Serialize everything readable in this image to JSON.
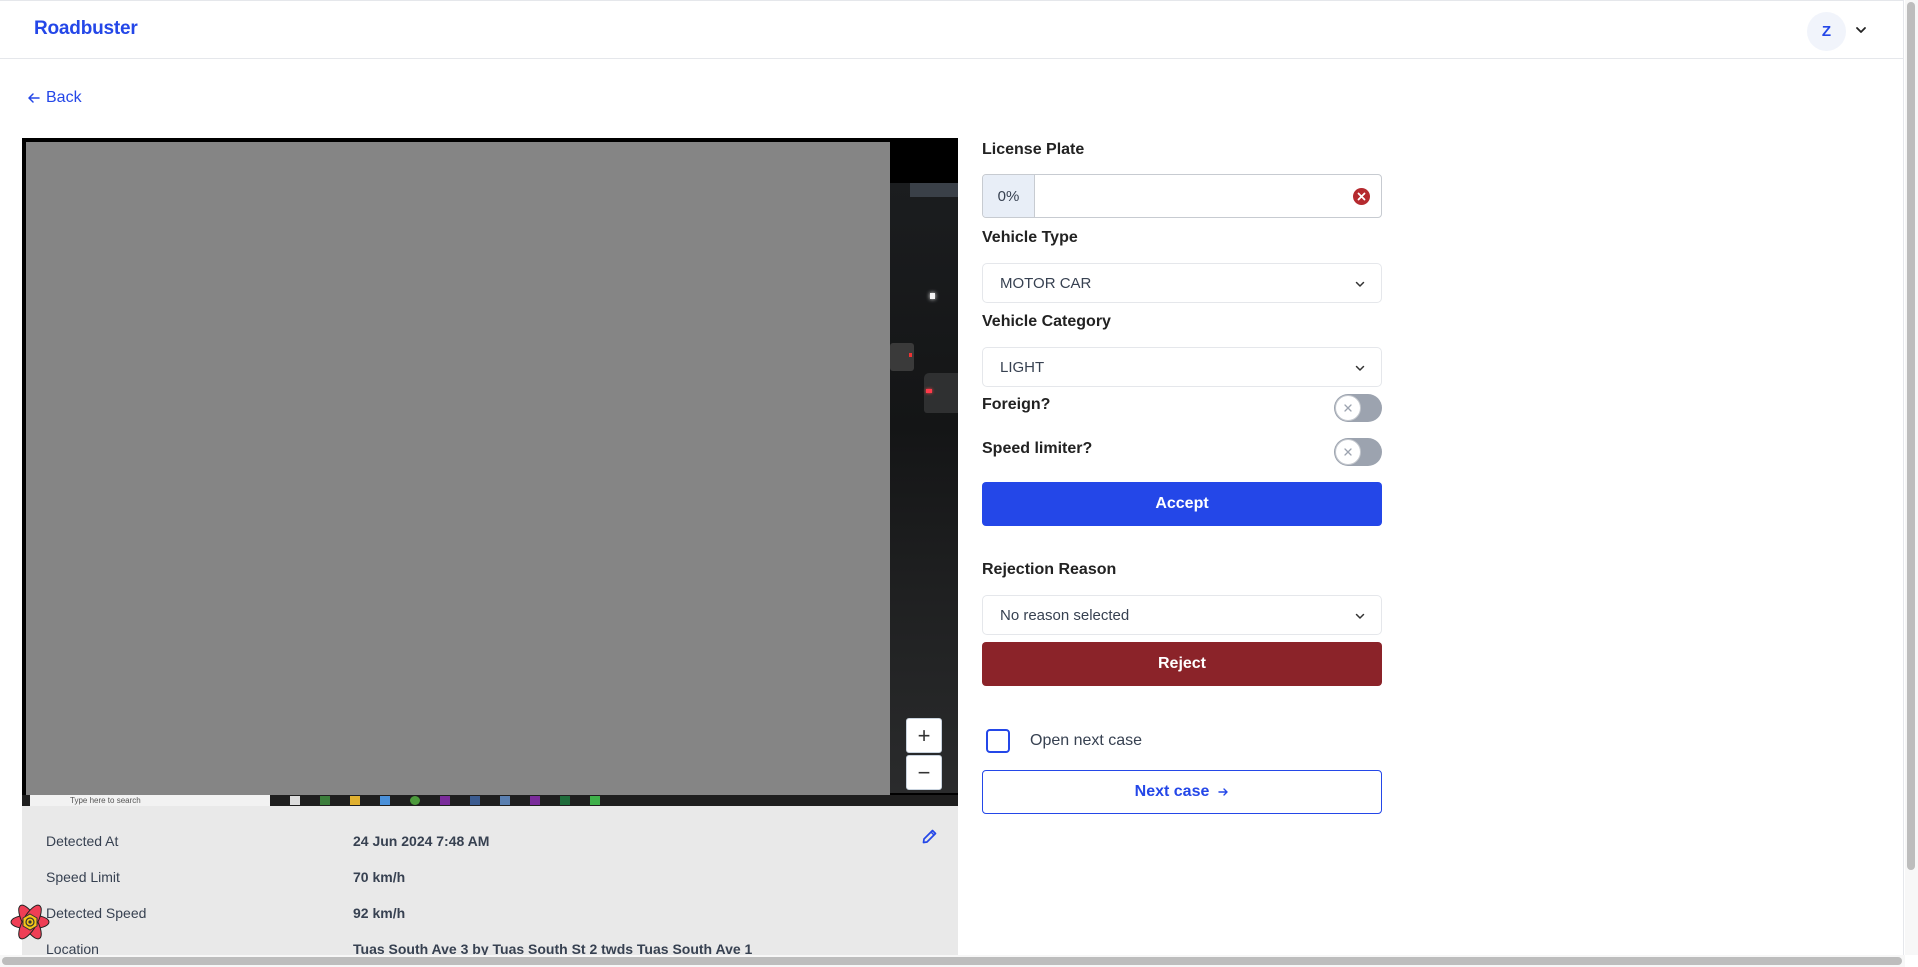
{
  "header": {
    "brand": "Roadbuster",
    "avatar_initial": "Z"
  },
  "nav": {
    "back_label": "Back"
  },
  "viewer": {
    "taskbar_search_text": "Type here to search",
    "zoom_in_label": "+",
    "zoom_out_label": "−"
  },
  "details": {
    "rows": [
      {
        "label": "Detected At",
        "value": "24 Jun 2024 7:48 AM"
      },
      {
        "label": "Speed Limit",
        "value": "70 km/h"
      },
      {
        "label": "Detected Speed",
        "value": "92 km/h"
      },
      {
        "label": "Location",
        "value": "Tuas South Ave 3 by Tuas South St 2 twds Tuas South Ave 1"
      }
    ]
  },
  "form": {
    "license_plate": {
      "label": "License Plate",
      "confidence": "0%",
      "value": "",
      "placeholder": ""
    },
    "vehicle_type": {
      "label": "Vehicle Type",
      "selected": "MOTOR CAR"
    },
    "vehicle_category": {
      "label": "Vehicle Category",
      "selected": "LIGHT"
    },
    "foreign": {
      "label": "Foreign?",
      "checked": false
    },
    "speed_limiter": {
      "label": "Speed limiter?",
      "checked": false
    },
    "accept_label": "Accept",
    "rejection_reason": {
      "label": "Rejection Reason",
      "selected": "No reason selected"
    },
    "reject_label": "Reject",
    "open_next_case": {
      "label": "Open next case",
      "checked": false
    },
    "next_case_label": "Next case"
  },
  "colors": {
    "primary": "#2447e8",
    "danger": "#8b2329",
    "clear_icon": "#b52a2f",
    "toggle_off": "#9ca3af"
  }
}
